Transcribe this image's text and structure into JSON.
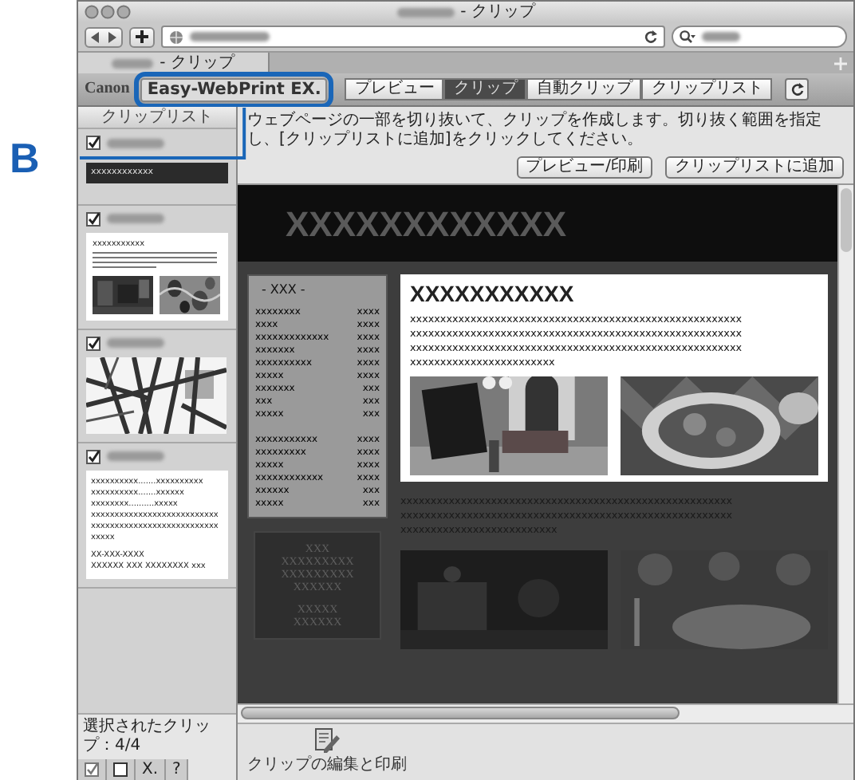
{
  "callout": {
    "label": "B"
  },
  "window": {
    "title": "- クリップ",
    "tab_title": "- クリップ"
  },
  "plugin": {
    "brand": "Canon",
    "product": "Easy-WebPrint EX.",
    "modes": [
      {
        "label": "プレビュー",
        "selected": false
      },
      {
        "label": "クリップ",
        "selected": true
      },
      {
        "label": "自動クリップ",
        "selected": false
      },
      {
        "label": "クリップリスト",
        "selected": false
      }
    ]
  },
  "sidebar": {
    "title": "クリップリスト",
    "clips": [
      {
        "kind": "text",
        "checked": true,
        "thumb_text": [
          "xxxxxxxxxxxx"
        ]
      },
      {
        "kind": "article",
        "checked": true,
        "thumb_text": [
          "xxxxxxxxxxx"
        ]
      },
      {
        "kind": "map",
        "checked": true
      },
      {
        "kind": "text-list",
        "checked": true,
        "thumb_text": [
          "xxxxxxxxxx.......xxxxxxxxxx",
          "xxxxxxxxxx.......xxxxxx",
          "xxxxxxxx..........xxxxx",
          "xxxxxxxxxxxxxxxxxxxxxxxxxxx",
          "xxxxxxxxxxxxxxxxxxxxxxxxxxx",
          "xxxxx",
          "XX-XXX-XXXX",
          "XXXXXX XXX XXXXXXXX xxx"
        ]
      }
    ],
    "status": "選択されたクリップ：4/4",
    "tool_buttons": [
      "X.",
      "?"
    ]
  },
  "clip_panel": {
    "instruction": "ウェブページの一部を切り抜いて、クリップを作成します。切り抜く範囲を指定し、[クリップリストに追加]をクリックしてください。",
    "buttons": [
      "プレビュー/印刷",
      "クリップリストに追加"
    ]
  },
  "page": {
    "banner": "XXXXXXXXXXXX",
    "menu_title": "- XXX -",
    "menu_groups": [
      [
        {
          "item": "xxxxxxxx",
          "price": "xxxx"
        },
        {
          "item": "xxxx",
          "price": "xxxx"
        },
        {
          "item": "xxxxxxxxxxxxx",
          "price": "xxxx"
        },
        {
          "item": "xxxxxxx",
          "price": "xxxx"
        },
        {
          "item": "xxxxxxxxxx",
          "price": "xxxx"
        },
        {
          "item": "xxxxx",
          "price": "xxxx"
        },
        {
          "item": "xxxxxxx",
          "price": "xxx"
        },
        {
          "item": "xxx",
          "price": "xxx"
        },
        {
          "item": "xxxxx",
          "price": "xxx"
        }
      ],
      [
        {
          "item": "xxxxxxxxxxx",
          "price": "xxxx"
        },
        {
          "item": "xxxxxxxxx",
          "price": "xxxx"
        },
        {
          "item": "xxxxx",
          "price": "xxxx"
        },
        {
          "item": "xxxxxxxxxxxx",
          "price": "xxxx"
        },
        {
          "item": "xxxxxx",
          "price": "xxx"
        },
        {
          "item": "xxxxx",
          "price": "xxx"
        }
      ]
    ],
    "headline": "XXXXXXXXXXX",
    "lines": [
      "xxxxxxxxxxxxxxxxxxxxxxxxxxxxxxxxxxxxxxxxxxxxxxxxxxxxxxx",
      "xxxxxxxxxxxxxxxxxxxxxxxxxxxxxxxxxxxxxxxxxxxxxxxxxxxxxxx",
      "xxxxxxxxxxxxxxxxxxxxxxxxxxxxxxxxxxxxxxxxxxxxxxxxxxxxxxx",
      "xxxxxxxxxxxxxxxxxxxxxxxx"
    ],
    "box_lines": [
      "XXX",
      "XXXXXXXXX",
      "XXXXXXXXX",
      "XXXXXX",
      "XXXXX",
      "XXXXXX"
    ],
    "lines_below": [
      "xxxxxxxxxxxxxxxxxxxxxxxxxxxxxxxxxxxxxxxxxxxxxxxxxxxxxxx",
      "xxxxxxxxxxxxxxxxxxxxxxxxxxxxxxxxxxxxxxxxxxxxxxxxxxxxxxx",
      "xxxxxxxxxxxxxxxxxxxxxxxxxx"
    ]
  },
  "footer": {
    "action": "クリップの編集と印刷"
  }
}
